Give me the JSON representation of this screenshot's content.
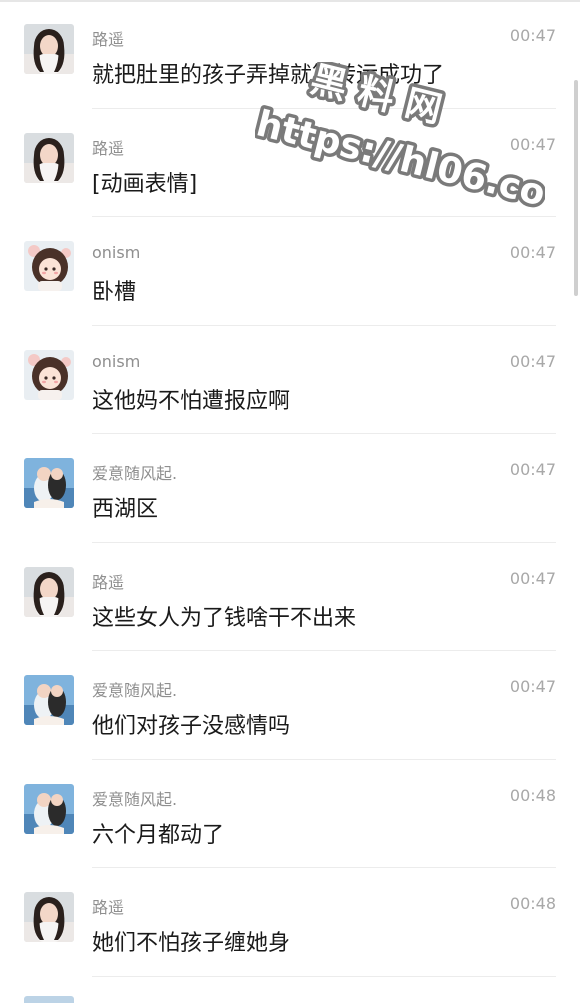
{
  "messages": [
    {
      "name": "路遥",
      "time": "00:47",
      "text": "就把肚里的孩子弄掉就算转运成功了",
      "avatar": "avatar-girl"
    },
    {
      "name": "路遥",
      "time": "00:47",
      "text": "[动画表情]",
      "avatar": "avatar-girl"
    },
    {
      "name": "onism",
      "time": "00:47",
      "text": "卧槽",
      "avatar": "avatar-cartoon"
    },
    {
      "name": "onism",
      "time": "00:47",
      "text": "这他妈不怕遭报应啊",
      "avatar": "avatar-cartoon"
    },
    {
      "name": "爱意随风起.",
      "time": "00:47",
      "text": "西湖区",
      "avatar": "avatar-couple"
    },
    {
      "name": "路遥",
      "time": "00:47",
      "text": "这些女人为了钱啥干不出来",
      "avatar": "avatar-girl"
    },
    {
      "name": "爱意随风起.",
      "time": "00:47",
      "text": "他们对孩子没感情吗",
      "avatar": "avatar-couple"
    },
    {
      "name": "爱意随风起.",
      "time": "00:48",
      "text": "六个月都动了",
      "avatar": "avatar-couple"
    },
    {
      "name": "路遥",
      "time": "00:48",
      "text": "她们不怕孩子缠她身",
      "avatar": "avatar-girl"
    }
  ],
  "watermark": {
    "line1": "黑 料 网",
    "line2": "https://hl06.co"
  }
}
